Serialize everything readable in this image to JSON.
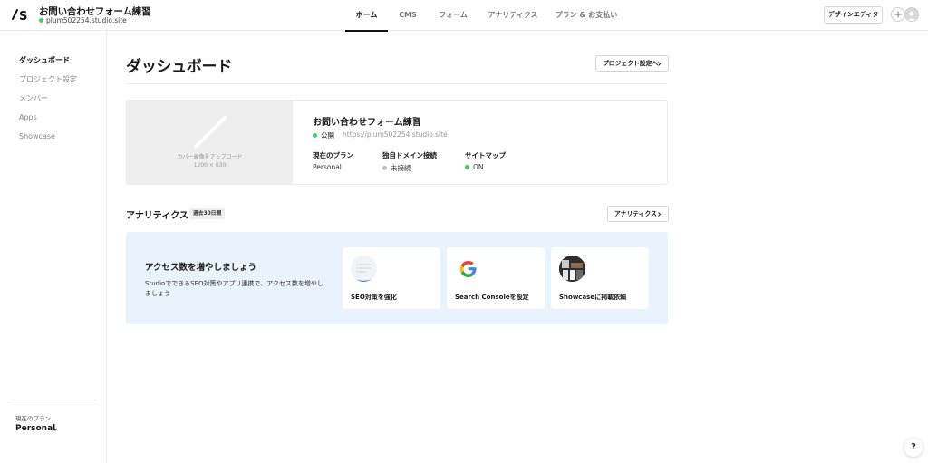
{
  "header": {
    "project_title": "お問い合わせフォーム練習",
    "project_url": "plum502254.studio.site",
    "nav": [
      {
        "label": "ホーム",
        "active": true
      },
      {
        "label": "CMS",
        "active": false
      },
      {
        "label": "フォーム",
        "active": false
      },
      {
        "label": "アナリティクス",
        "active": false
      },
      {
        "label": "プラン & お支払い",
        "active": false
      }
    ],
    "design_editor_label": "デザインエディタ"
  },
  "sidebar": {
    "items": [
      {
        "label": "ダッシュボード",
        "active": true
      },
      {
        "label": "プロジェクト設定",
        "active": false
      },
      {
        "label": "メンバー",
        "active": false
      },
      {
        "label": "Apps",
        "active": false
      },
      {
        "label": "Showcase",
        "active": false
      }
    ],
    "plan_label": "現在のプラン",
    "plan_value": "Personal"
  },
  "main": {
    "title": "ダッシュボード",
    "project_settings_button": "プロジェクト設定へ",
    "project_card": {
      "cover_label": "カバー画像をアップロード",
      "cover_size": "1200 × 630",
      "title": "お問い合わせフォーム練習",
      "status": "公開",
      "url": "https://plum502254.studio.site",
      "plan_label": "現在のプラン",
      "plan_value": "Personal",
      "domain_label": "独自ドメイン接続",
      "domain_value": "未接続",
      "sitemap_label": "サイトマップ",
      "sitemap_value": "ON"
    },
    "analytics": {
      "title": "アナリティクス",
      "period_badge": "過去30日間",
      "button_label": "アナリティクス",
      "promo_title": "アクセス数を増やしましょう",
      "promo_desc": "StudioでできるSEO対策やアプリ連携で、アクセス数を増やしましょう",
      "tiles": [
        {
          "label": "SEO対策を強化",
          "icon": "seo-icon"
        },
        {
          "label": "Search Consoleを設定",
          "icon": "google-icon"
        },
        {
          "label": "Showcaseに掲載依頼",
          "icon": "showcase-icon"
        }
      ]
    }
  },
  "help_label": "?",
  "colors": {
    "status_green": "#3ccf6e",
    "promo_bg": "#e9f3fc",
    "cover_bg": "#eeeeee"
  }
}
